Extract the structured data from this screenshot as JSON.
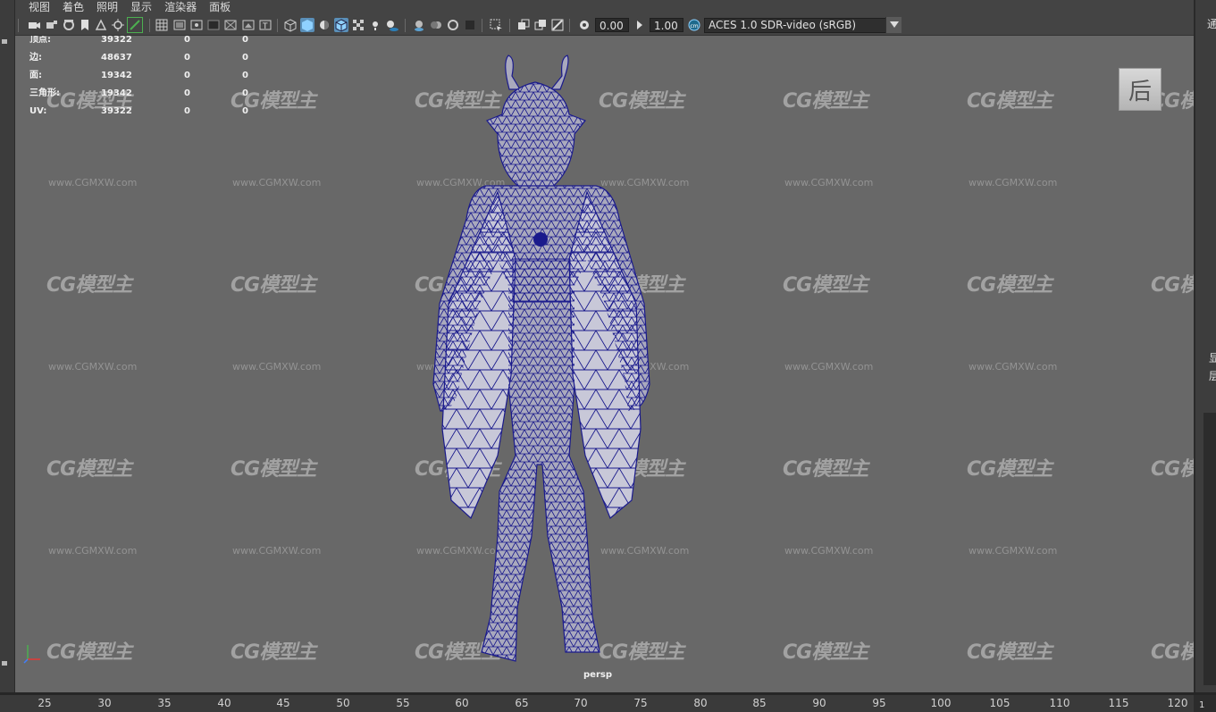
{
  "menu": [
    "视图",
    "着色",
    "照明",
    "显示",
    "渲染器",
    "面板"
  ],
  "toolbar": {
    "exposure": "0.00",
    "gamma": "1.00",
    "color_space": "ACES 1.0 SDR-video (sRGB)"
  },
  "hud": {
    "rows": [
      {
        "label": "顶点:",
        "total": "39322",
        "selected": "0",
        "comp": "0"
      },
      {
        "label": "边:",
        "total": "48637",
        "selected": "0",
        "comp": "0"
      },
      {
        "label": "面:",
        "total": "19342",
        "selected": "0",
        "comp": "0"
      },
      {
        "label": "三角形:",
        "total": "19342",
        "selected": "0",
        "comp": "0"
      },
      {
        "label": "UV:",
        "total": "39322",
        "selected": "0",
        "comp": "0"
      }
    ]
  },
  "viewport": {
    "camera": "persp",
    "view_cube": "后",
    "watermark_logo": "CG模型主",
    "watermark_url": "www.CGMXW.com",
    "wire_color": "#1a1a8c",
    "background": "#686868"
  },
  "right_panel": {
    "top": "通",
    "mid1": "显",
    "mid2": "层"
  },
  "timeline": {
    "ticks": [
      "25",
      "30",
      "35",
      "40",
      "45",
      "50",
      "55",
      "60",
      "65",
      "70",
      "75",
      "80",
      "85",
      "90",
      "95",
      "100",
      "105",
      "110",
      "115",
      "120"
    ],
    "corner": "1"
  }
}
